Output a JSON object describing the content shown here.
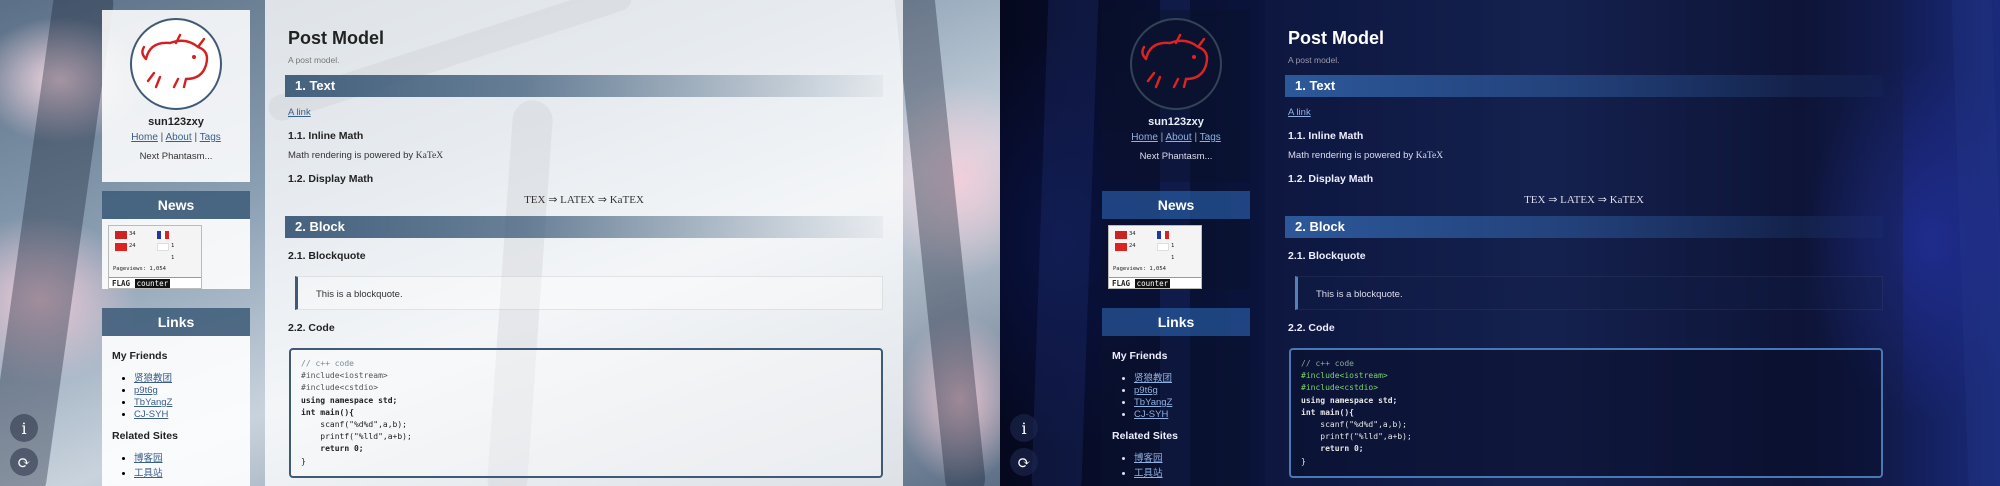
{
  "post": {
    "title": "Post Model",
    "subtitle": "A post model.",
    "sections": {
      "text_heading": "1. Text",
      "link_text": "A link",
      "inline_math_heading": "1.1. Inline Math",
      "inline_math_text": "Math rendering is powered by ",
      "katex": "KaTeX",
      "display_math_heading": "1.2. Display Math",
      "display_math": "TEX ⇒ LATEX ⇒ KaTEX",
      "block_heading": "2. Block",
      "blockquote_heading": "2.1. Blockquote",
      "blockquote_text": "This is a blockquote.",
      "code_heading": "2.2. Code",
      "code_lines": [
        "// c++ code",
        "#include<iostream>",
        "#include<cstdio>",
        "using namespace std;",
        "int main(){",
        "    scanf(\"%d%d\",a,b);",
        "    printf(\"%lld\",a+b);",
        "    return 0;",
        "}"
      ]
    }
  },
  "sidebar": {
    "username": "sun123zxy",
    "nav": [
      "Home",
      "About",
      "Tags"
    ],
    "separator": "|",
    "tagline": "Next Phantasm...",
    "news_title": "News",
    "flag_counter": {
      "rows": [
        {
          "count": "34"
        },
        {
          "count": "24"
        },
        {
          "count": "1"
        },
        {
          "count": "1"
        }
      ],
      "pageviews": "Pageviews: 1,054",
      "brand": "FLAG",
      "brand_suffix": "counter"
    },
    "links_title": "Links",
    "friends_title": "My Friends",
    "friends": [
      "贤狼教团",
      "p9t6g",
      "TbYangZ",
      "CJ-SYH"
    ],
    "related_title": "Related Sites",
    "related": [
      "博客园",
      "工具站"
    ]
  },
  "fab": {
    "info_icon": "info-icon",
    "theme_icon": "theme-toggle-icon",
    "info_glyph": "i",
    "theme_glyph": "⟳"
  },
  "themes": {
    "light": "light",
    "dark": "dark"
  }
}
